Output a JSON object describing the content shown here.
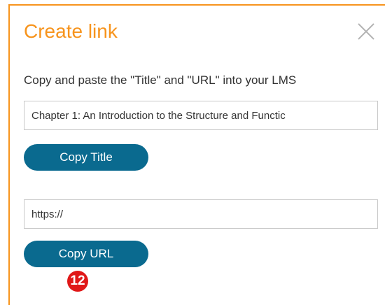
{
  "dialog": {
    "title": "Create link",
    "close_icon": "close-icon",
    "instructions": "Copy and paste the \"Title\" and \"URL\" into your LMS",
    "title_field_value": "Chapter 1: An Introduction to the Structure and Functic",
    "copy_title_label": "Copy Title",
    "url_field_value": "https://",
    "copy_url_label": "Copy URL",
    "step_badge": "12"
  },
  "colors": {
    "accent": "#f7941d",
    "button": "#0a6a8f",
    "badge": "#e01818"
  }
}
